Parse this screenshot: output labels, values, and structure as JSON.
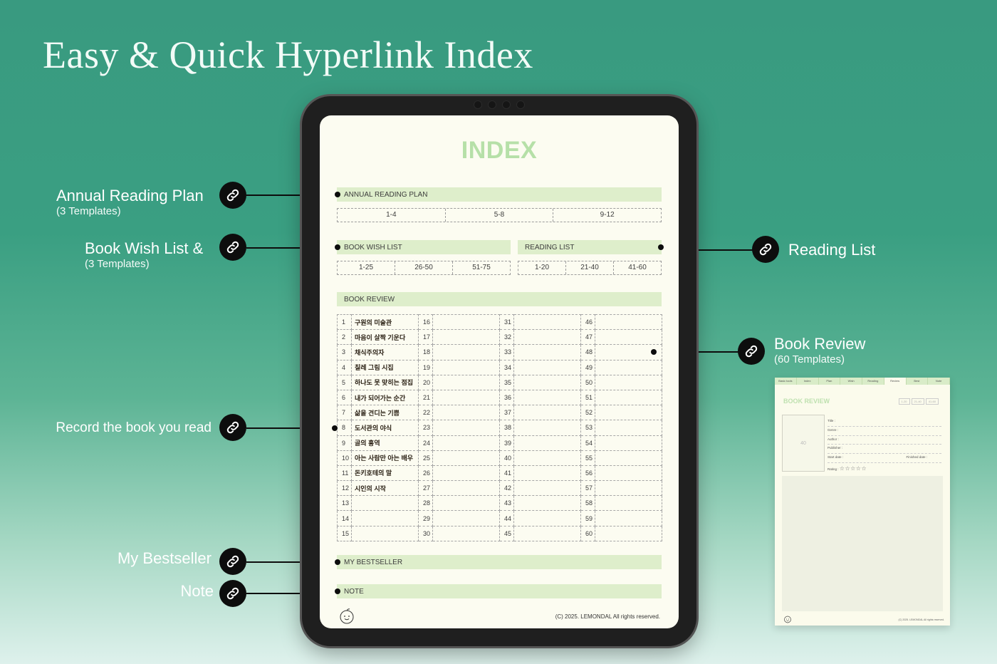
{
  "headline": "Easy & Quick Hyperlink Index",
  "callouts": {
    "annual": {
      "title": "Annual Reading Plan",
      "subtitle": "(3 Templates)"
    },
    "wish": {
      "title": "Book Wish List &",
      "subtitle": "(3 Templates)"
    },
    "reading": {
      "title": "Reading List"
    },
    "review": {
      "title": "Book Review",
      "subtitle": "(60 Templates)"
    },
    "record": {
      "title": "Record the book you read"
    },
    "bestseller": {
      "title": "My Bestseller"
    },
    "note": {
      "title": "Note"
    }
  },
  "screen": {
    "title": "INDEX",
    "annual_plan": {
      "label": "ANNUAL READING PLAN",
      "ranges": [
        "1-4",
        "5-8",
        "9-12"
      ]
    },
    "wish_list": {
      "label": "BOOK WISH LIST",
      "ranges": [
        "1-25",
        "26-50",
        "51-75"
      ]
    },
    "reading_list": {
      "label": "READING LIST",
      "ranges": [
        "1-20",
        "21-40",
        "41-60"
      ]
    },
    "book_review": {
      "label": "BOOK REVIEW",
      "rows": [
        {
          "n1": "1",
          "t1": "구원의 미술관",
          "n2": "16",
          "n3": "31",
          "n4": "46"
        },
        {
          "n1": "2",
          "t1": "마음이 살짝 기운다",
          "n2": "17",
          "n3": "32",
          "n4": "47"
        },
        {
          "n1": "3",
          "t1": "채식주의자",
          "n2": "18",
          "n3": "33",
          "n4": "48"
        },
        {
          "n1": "4",
          "t1": "칠레 그림 시집",
          "n2": "19",
          "n3": "34",
          "n4": "49"
        },
        {
          "n1": "5",
          "t1": "하나도 못 맞히는 점집",
          "n2": "20",
          "n3": "35",
          "n4": "50"
        },
        {
          "n1": "6",
          "t1": "내가 되어가는 순간",
          "n2": "21",
          "n3": "36",
          "n4": "51"
        },
        {
          "n1": "7",
          "t1": "삶을 견디는 기쁨",
          "n2": "22",
          "n3": "37",
          "n4": "52"
        },
        {
          "n1": "8",
          "t1": "도서관의 야식",
          "n2": "23",
          "n3": "38",
          "n4": "53"
        },
        {
          "n1": "9",
          "t1": "골의 흉역",
          "n2": "24",
          "n3": "39",
          "n4": "54"
        },
        {
          "n1": "10",
          "t1": "아는 사람만 아는 배우",
          "n2": "25",
          "n3": "40",
          "n4": "55"
        },
        {
          "n1": "11",
          "t1": "돈키호테의 말",
          "n2": "26",
          "n3": "41",
          "n4": "56"
        },
        {
          "n1": "12",
          "t1": "시인의 시작",
          "n2": "27",
          "n3": "42",
          "n4": "57"
        },
        {
          "n1": "13",
          "t1": "",
          "n2": "28",
          "n3": "43",
          "n4": "58"
        },
        {
          "n1": "14",
          "t1": "",
          "n2": "29",
          "n3": "44",
          "n4": "59"
        },
        {
          "n1": "15",
          "t1": "",
          "n2": "30",
          "n3": "45",
          "n4": "60"
        }
      ]
    },
    "bestseller": {
      "label": "MY BESTSELLER"
    },
    "note": {
      "label": "NOTE"
    },
    "copyright": "(C) 2025. LEMONDAL All rights reserved."
  },
  "preview": {
    "tabs": [
      "Basic tools",
      "Index",
      "Plan",
      "Wish",
      "Reading",
      "Review",
      "Best",
      "Note"
    ],
    "active_tab": "Review",
    "title": "BOOK REVIEW",
    "ranges": [
      "1-20",
      "21-40",
      "41-60"
    ],
    "cover_number": "40",
    "fields": {
      "title": "Title :",
      "genre": "Genre :",
      "author": "Author :",
      "publisher": "Publisher :",
      "start": "Start date :",
      "finished": "Finished date :"
    },
    "rating_label": "Rating :",
    "rating_stars": "☆☆☆☆☆",
    "copyright": "(C) 2025. LEMONDAL All rights reserved."
  },
  "colors": {
    "accent_green": "#deeecb",
    "index_title": "#b6e0a8",
    "page_bg": "#fcfcf1",
    "badge": "#0d0d0d"
  },
  "icons": [
    "link-icon",
    "smiley-icon",
    "camera-icon"
  ]
}
